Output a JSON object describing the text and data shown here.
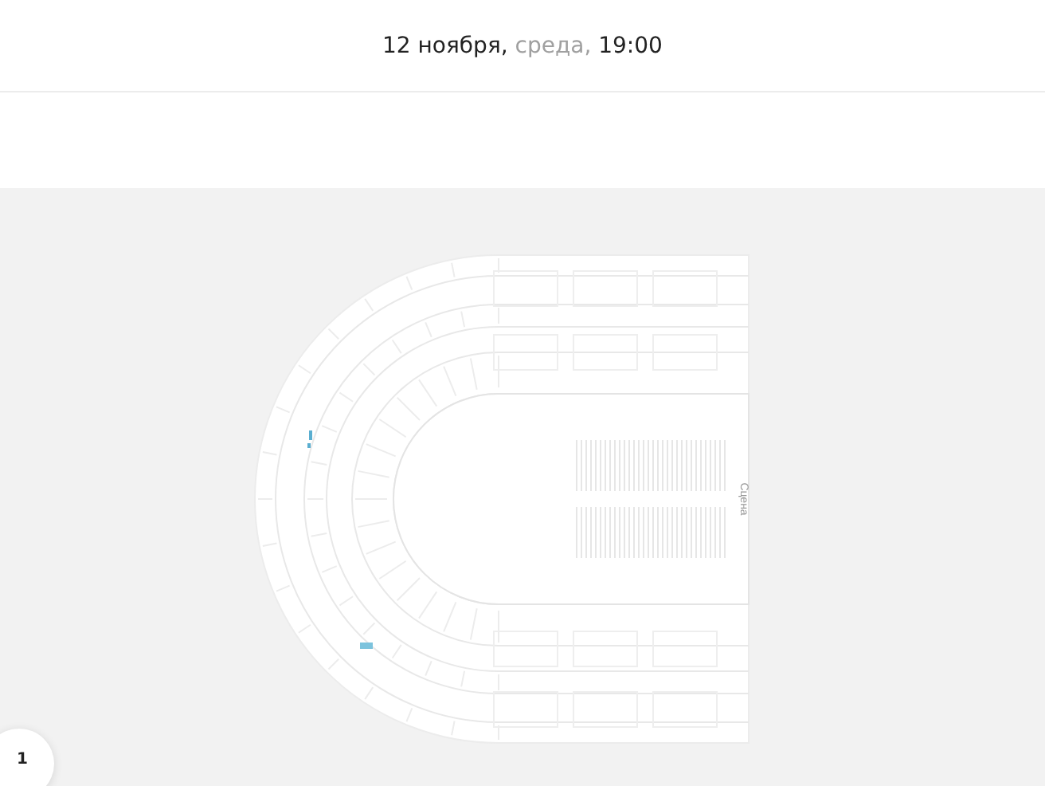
{
  "header": {
    "date": "12 ноября,",
    "weekday": "среда,",
    "time": "19:00"
  },
  "hall_map": {
    "stage_label": "Сцена"
  },
  "badge": {
    "count": "1"
  }
}
